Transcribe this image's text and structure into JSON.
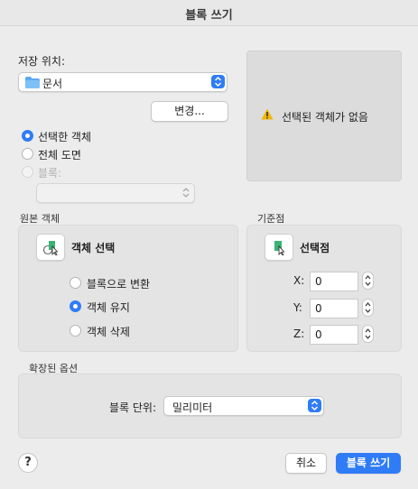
{
  "window": {
    "title": "블록 쓰기"
  },
  "save_location": {
    "label": "저장 위치:",
    "value": "문서",
    "change_button": "변경..."
  },
  "preview": {
    "message": "선택된 객체가 없음"
  },
  "source": {
    "options": [
      "선택한 객체",
      "전체 도면",
      "블록:"
    ],
    "selected_index": 0,
    "block_dropdown_value": ""
  },
  "objects_group": {
    "label": "원본 객체",
    "select_button": "객체 선택",
    "options": [
      "블록으로 변환",
      "객체 유지",
      "객체 삭제"
    ],
    "selected_index": 1
  },
  "base_point": {
    "label": "기준점",
    "pick_button": "선택점",
    "x_label": "X:",
    "x_value": "0",
    "y_label": "Y:",
    "y_value": "0",
    "z_label": "Z:",
    "z_value": "0"
  },
  "extended": {
    "label": "확장된 옵션",
    "units_label": "블록 단위:",
    "units_value": "밀리미터"
  },
  "footer": {
    "help": "?",
    "cancel": "취소",
    "ok": "블록 쓰기"
  },
  "colors": {
    "accent": "#2f7cf6",
    "warning": "#f2b705",
    "object_green": "#3bb273"
  }
}
